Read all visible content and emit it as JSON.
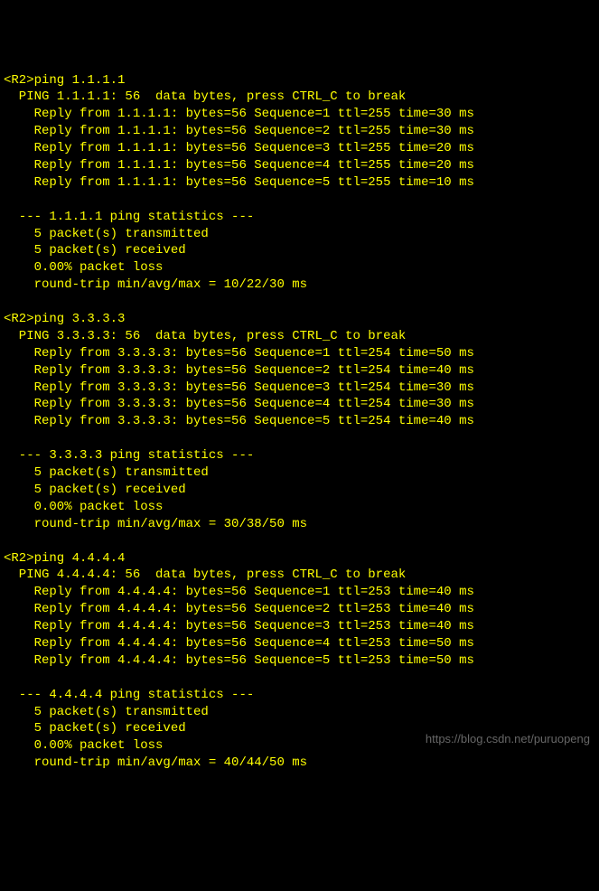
{
  "pings": [
    {
      "prompt": "<R2>",
      "command": "ping 1.1.1.1",
      "header": "  PING 1.1.1.1: 56  data bytes, press CTRL_C to break",
      "replies": [
        "    Reply from 1.1.1.1: bytes=56 Sequence=1 ttl=255 time=30 ms",
        "    Reply from 1.1.1.1: bytes=56 Sequence=2 ttl=255 time=30 ms",
        "    Reply from 1.1.1.1: bytes=56 Sequence=3 ttl=255 time=20 ms",
        "    Reply from 1.1.1.1: bytes=56 Sequence=4 ttl=255 time=20 ms",
        "    Reply from 1.1.1.1: bytes=56 Sequence=5 ttl=255 time=10 ms"
      ],
      "stats_header": "  --- 1.1.1.1 ping statistics ---",
      "stats": [
        "    5 packet(s) transmitted",
        "    5 packet(s) received",
        "    0.00% packet loss",
        "    round-trip min/avg/max = 10/22/30 ms"
      ]
    },
    {
      "prompt": "<R2>",
      "command": "ping 3.3.3.3",
      "header": "  PING 3.3.3.3: 56  data bytes, press CTRL_C to break",
      "replies": [
        "    Reply from 3.3.3.3: bytes=56 Sequence=1 ttl=254 time=50 ms",
        "    Reply from 3.3.3.3: bytes=56 Sequence=2 ttl=254 time=40 ms",
        "    Reply from 3.3.3.3: bytes=56 Sequence=3 ttl=254 time=30 ms",
        "    Reply from 3.3.3.3: bytes=56 Sequence=4 ttl=254 time=30 ms",
        "    Reply from 3.3.3.3: bytes=56 Sequence=5 ttl=254 time=40 ms"
      ],
      "stats_header": "  --- 3.3.3.3 ping statistics ---",
      "stats": [
        "    5 packet(s) transmitted",
        "    5 packet(s) received",
        "    0.00% packet loss",
        "    round-trip min/avg/max = 30/38/50 ms"
      ]
    },
    {
      "prompt": "<R2>",
      "command": "ping 4.4.4.4",
      "header": "  PING 4.4.4.4: 56  data bytes, press CTRL_C to break",
      "replies": [
        "    Reply from 4.4.4.4: bytes=56 Sequence=1 ttl=253 time=40 ms",
        "    Reply from 4.4.4.4: bytes=56 Sequence=2 ttl=253 time=40 ms",
        "    Reply from 4.4.4.4: bytes=56 Sequence=3 ttl=253 time=40 ms",
        "    Reply from 4.4.4.4: bytes=56 Sequence=4 ttl=253 time=50 ms",
        "    Reply from 4.4.4.4: bytes=56 Sequence=5 ttl=253 time=50 ms"
      ],
      "stats_header": "  --- 4.4.4.4 ping statistics ---",
      "stats": [
        "    5 packet(s) transmitted",
        "    5 packet(s) received",
        "    0.00% packet loss",
        "    round-trip min/avg/max = 40/44/50 ms"
      ]
    }
  ],
  "watermark": "https://blog.csdn.net/puruopeng"
}
